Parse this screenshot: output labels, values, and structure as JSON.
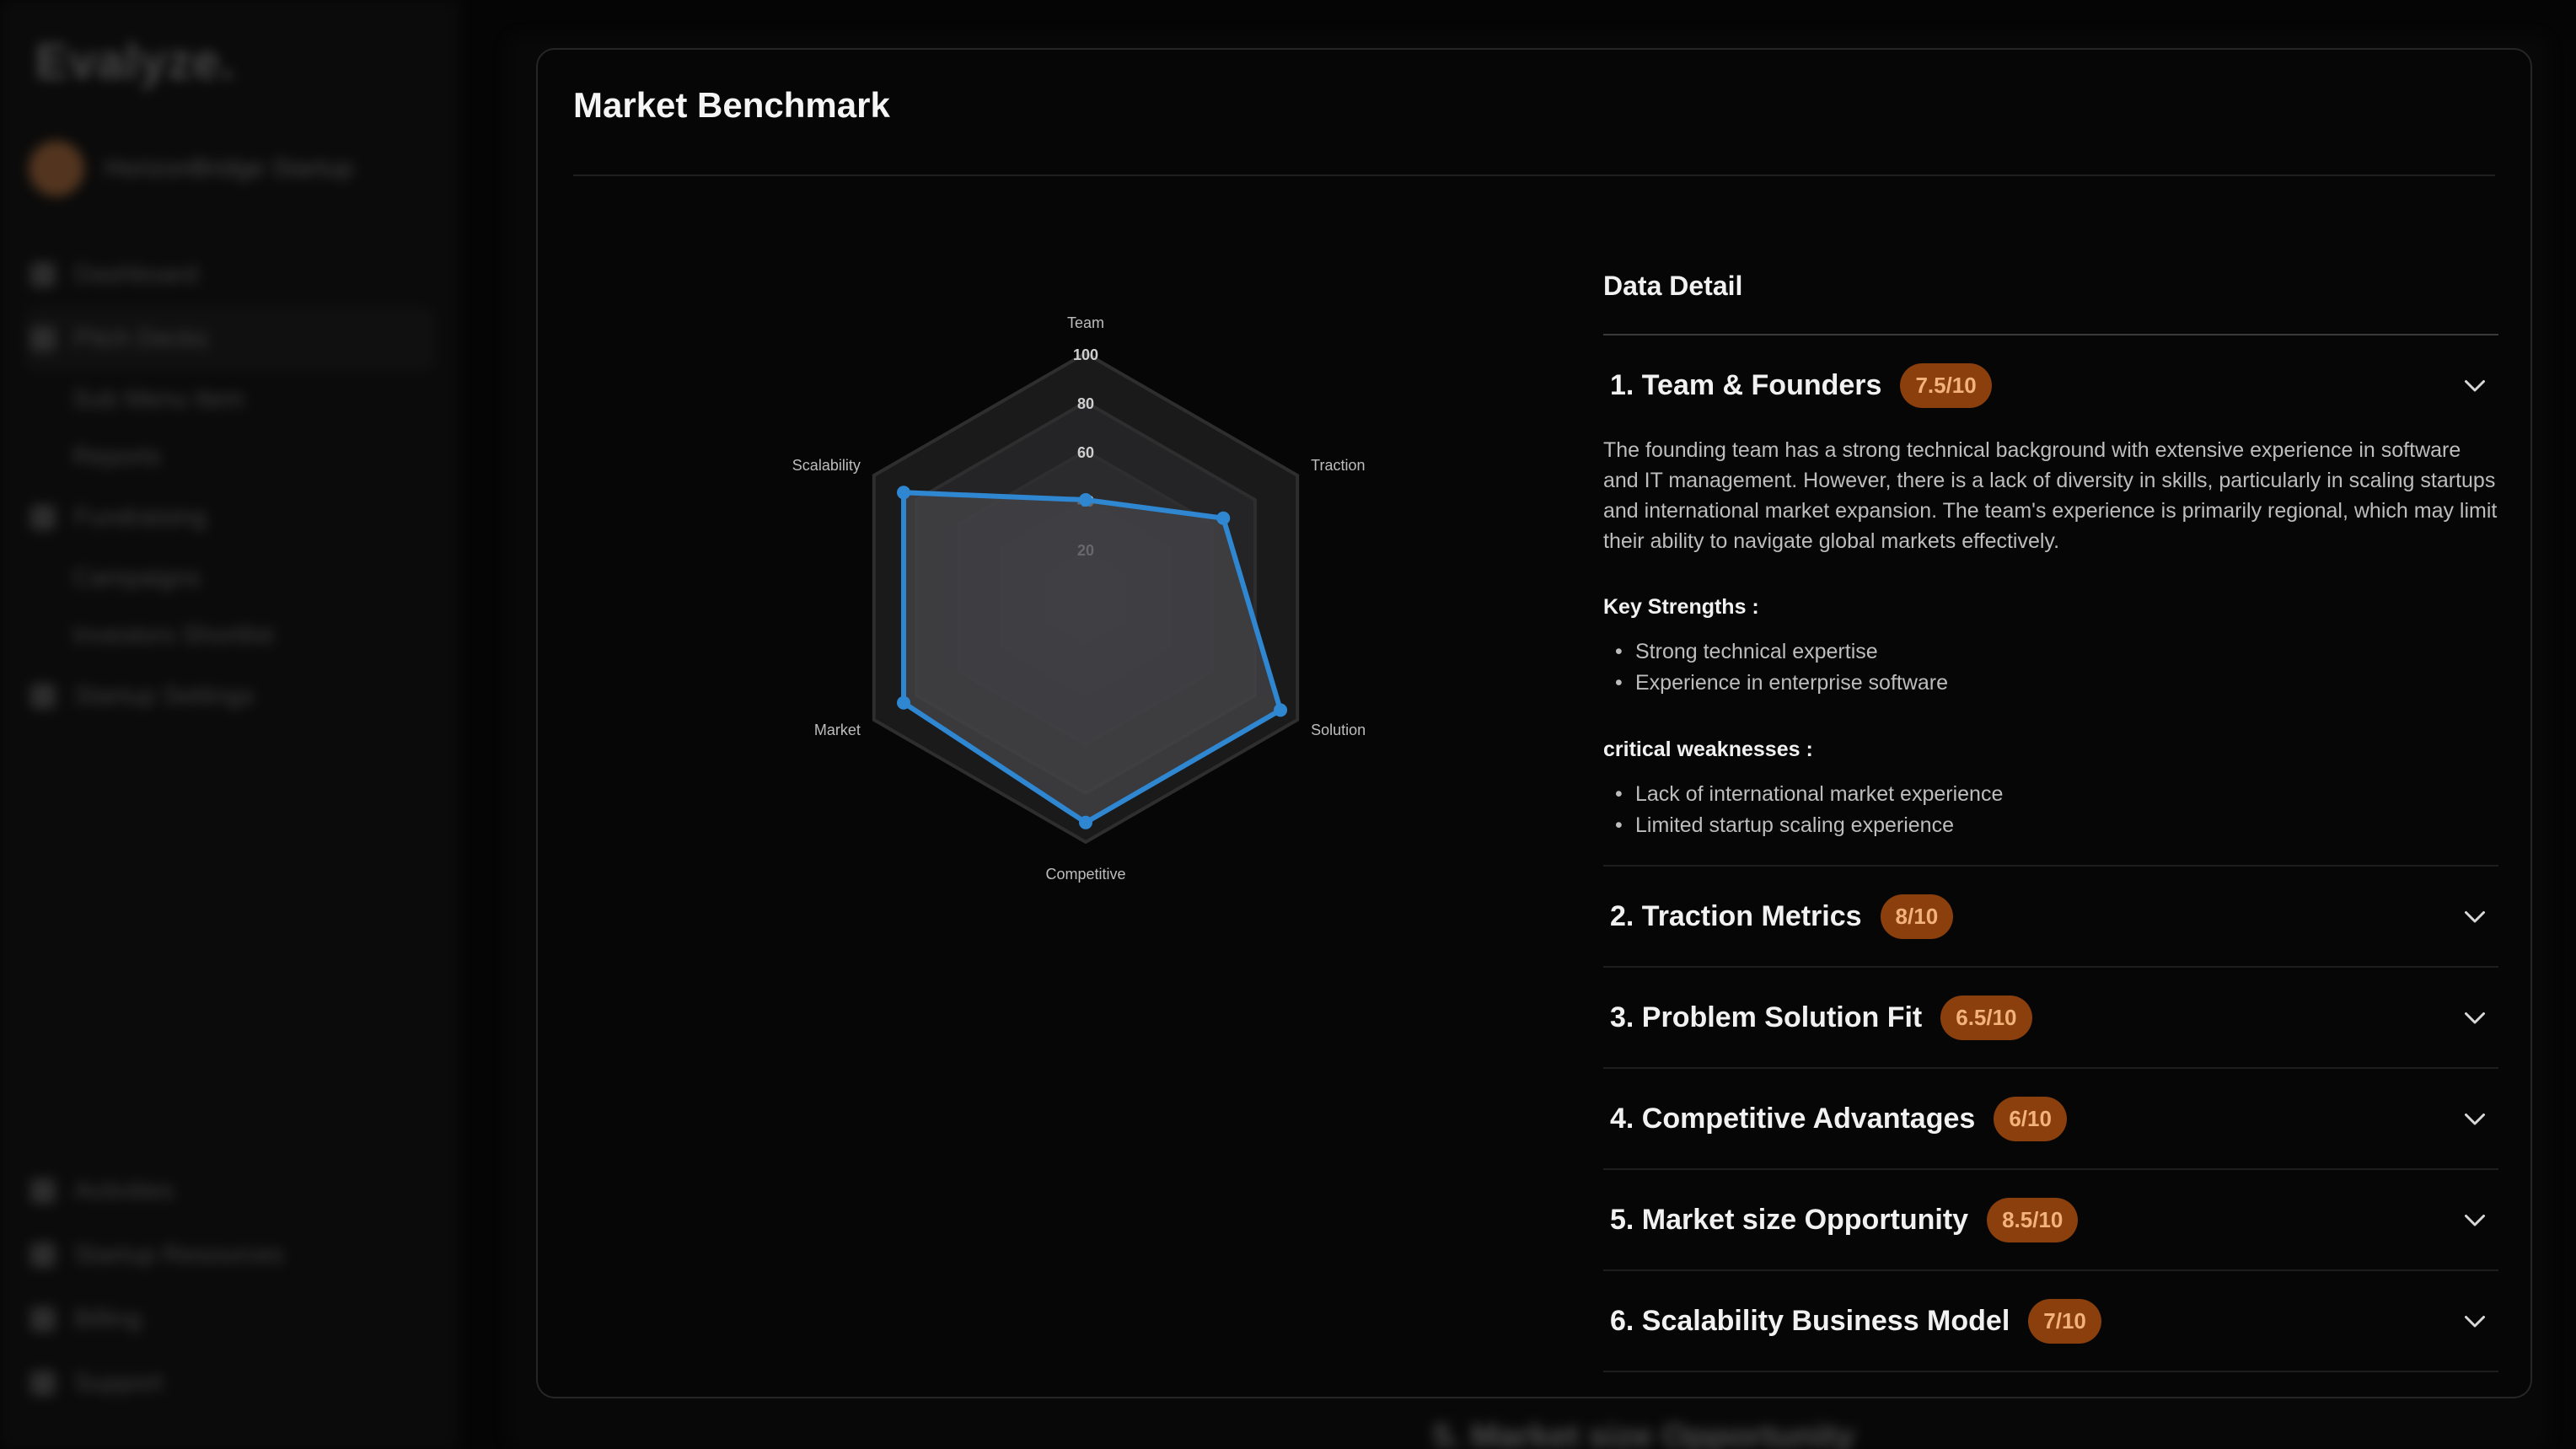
{
  "background": {
    "logo": "Evalyze.",
    "account_name": "HorizonBridge Startup",
    "nav": [
      {
        "label": "Dashboard",
        "sub": false,
        "active": false
      },
      {
        "label": "Pitch Decks",
        "sub": false,
        "active": true
      },
      {
        "label": "Sub Menu Item",
        "sub": true,
        "active": false
      },
      {
        "label": "Reports",
        "sub": true,
        "active": false
      },
      {
        "label": "Fundraising",
        "sub": false,
        "active": false
      },
      {
        "label": "Campaigns",
        "sub": true,
        "active": false
      },
      {
        "label": "Investors Shortlist",
        "sub": true,
        "active": false
      },
      {
        "label": "Startup Settings",
        "sub": false,
        "active": false
      }
    ],
    "nav_bottom": [
      {
        "label": "Activities"
      },
      {
        "label": "Startup Resources"
      },
      {
        "label": "Billing"
      },
      {
        "label": "Support"
      }
    ],
    "peek_text": "5. Market size Opportunity"
  },
  "modal": {
    "title": "Market Benchmark",
    "detail_title": "Data Detail",
    "items": [
      {
        "label": "1. Team & Founders",
        "score": "7.5/10",
        "expanded": true,
        "description": "The founding team has a strong technical background with extensive experience in software and IT management. However, there is a lack of diversity in skills, particularly in scaling startups and international market expansion. The team's experience is primarily regional, which may limit their ability to navigate global markets effectively.",
        "strengths_label": "Key Strengths :",
        "strengths": [
          "Strong technical expertise",
          "Experience in enterprise software"
        ],
        "weaknesses_label": "critical weaknesses :",
        "weaknesses": [
          "Lack of international market experience",
          "Limited startup scaling experience"
        ]
      },
      {
        "label": "2. Traction Metrics",
        "score": "8/10",
        "expanded": false
      },
      {
        "label": "3. Problem Solution Fit",
        "score": "6.5/10",
        "expanded": false
      },
      {
        "label": "4. Competitive Advantages",
        "score": "6/10",
        "expanded": false
      },
      {
        "label": "5. Market size Opportunity",
        "score": "8.5/10",
        "expanded": false
      },
      {
        "label": "6. Scalability Business Model",
        "score": "7/10",
        "expanded": false
      }
    ]
  },
  "chart_data": {
    "type": "radar",
    "axes": [
      "Team",
      "Traction",
      "Solution",
      "Competitive",
      "Market",
      "Scalability"
    ],
    "series": [
      {
        "values": [
          40,
          65,
          92,
          92,
          86,
          86
        ]
      }
    ],
    "rlim": [
      0,
      100
    ],
    "ticks": [
      20,
      40,
      60,
      80,
      100
    ],
    "grid": true,
    "colors": {
      "line": "#2f86d1",
      "fill": "#3a3a3d",
      "grid": "#2e2e2e",
      "badge_bg": "#8a3f0c",
      "badge_text": "#f3b27a"
    }
  }
}
